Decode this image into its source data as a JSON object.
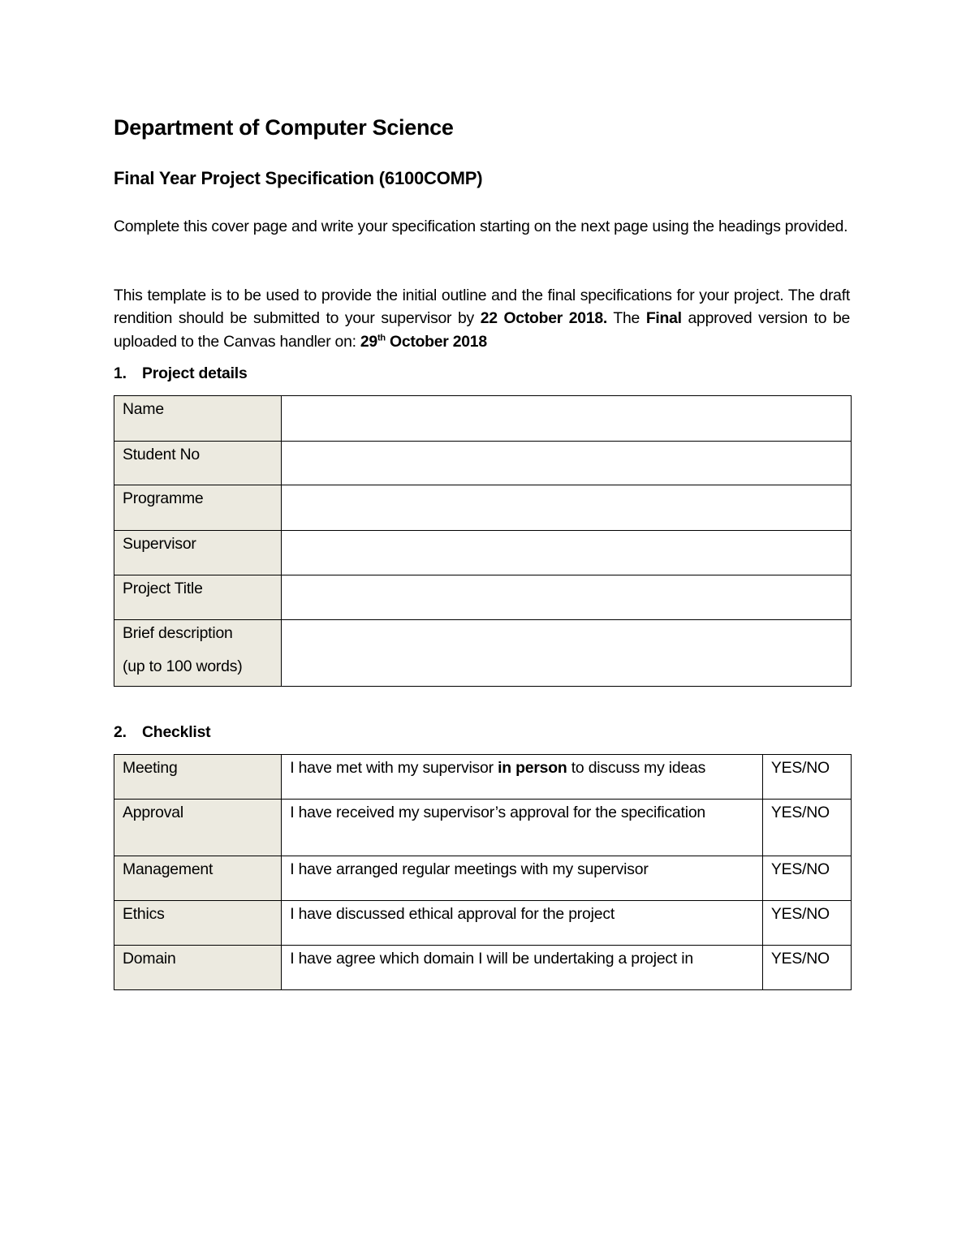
{
  "document": {
    "heading": "Department of Computer Science",
    "subheading": "Final Year Project Specification (6100COMP)",
    "intro": "Complete this cover page and write your specification starting on the next page using the headings provided.",
    "template_note": {
      "part1": "This template is to be used to provide the initial outline and the final specifications for your project.  The draft rendition should be submitted to your supervisor by ",
      "draft_deadline": "22 October 2018.",
      "part2": "  The ",
      "final_word": "Final",
      "part3": " approved version to be uploaded to the Canvas handler on: ",
      "final_day": "29",
      "final_day_suffix": "th",
      "final_rest": " October 2018"
    }
  },
  "sections": {
    "project_details": {
      "number": "1.",
      "title": "Project details",
      "rows": [
        {
          "label": "Name",
          "value": ""
        },
        {
          "label": "Student No",
          "value": ""
        },
        {
          "label": "Programme",
          "value": ""
        },
        {
          "label": "Supervisor",
          "value": ""
        },
        {
          "label": "Project Title",
          "value": ""
        },
        {
          "label": "Brief description",
          "label_line2": "(up to 100 words)",
          "value": ""
        }
      ]
    },
    "checklist": {
      "number": "2.",
      "title": "Checklist",
      "rows": [
        {
          "label": "Meeting",
          "statement_pre": "I have met with my supervisor ",
          "statement_bold": "in person",
          "statement_post": " to discuss my ideas",
          "answer": "YES/NO"
        },
        {
          "label": "Approval",
          "statement": "I have received my supervisor’s approval for the specification",
          "answer": "YES/NO"
        },
        {
          "label": "Management",
          "statement": "I have arranged regular meetings with my supervisor",
          "answer": "YES/NO"
        },
        {
          "label": "Ethics",
          "statement": "I have discussed ethical approval for the project",
          "answer": "YES/NO"
        },
        {
          "label": "Domain",
          "statement": "I have agree which domain I will be undertaking a project in",
          "answer": "YES/NO"
        }
      ]
    }
  },
  "colors": {
    "label_cell_bg": "#eceae0",
    "text": "#000000"
  }
}
